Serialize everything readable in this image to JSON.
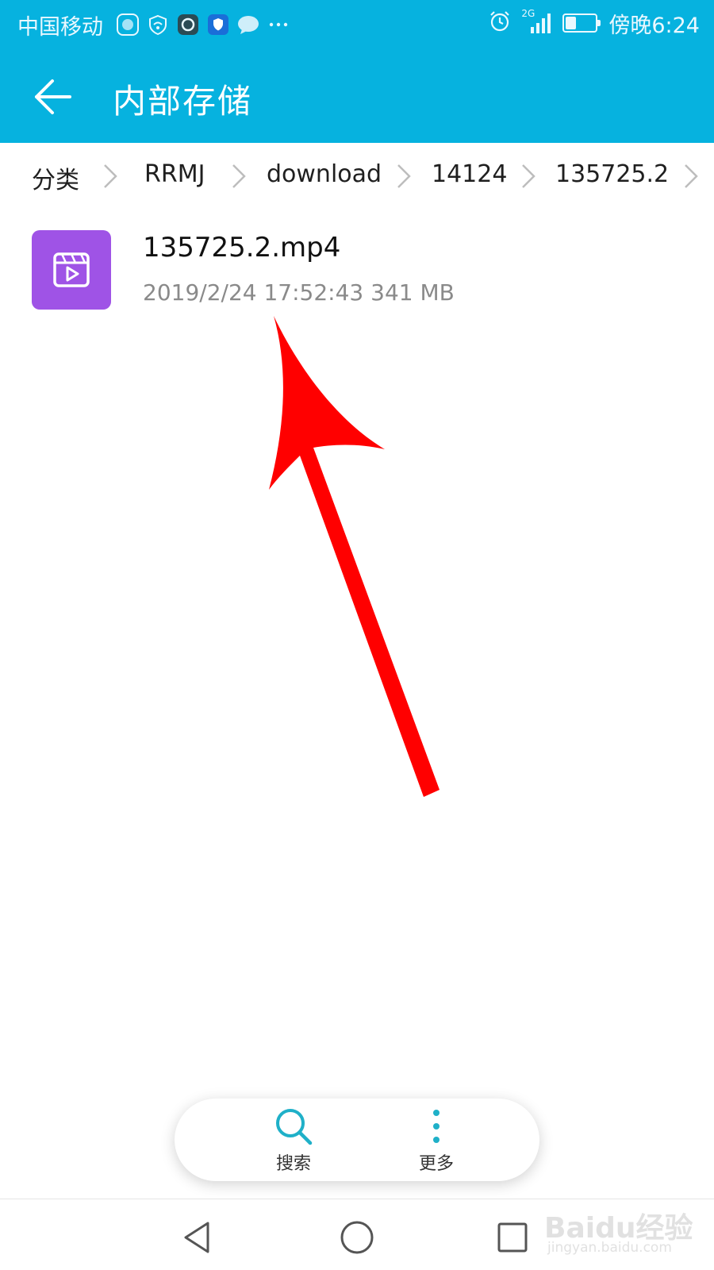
{
  "status_bar": {
    "carrier": "中国移动",
    "network_label": "2G",
    "time": "傍晚6:24",
    "battery_level": 0.35
  },
  "header": {
    "title": "内部存储"
  },
  "breadcrumb": {
    "items": [
      "分类",
      "RRMJ",
      "download",
      "14124",
      "135725.2"
    ]
  },
  "files": [
    {
      "name": "135725.2.mp4",
      "meta": "2019/2/24 17:52:43 341 MB"
    }
  ],
  "actions": {
    "search_label": "搜索",
    "more_label": "更多"
  },
  "watermark": {
    "brand": "Baidu经验",
    "url": "jingyan.baidu.com"
  },
  "colors": {
    "accent": "#06b2df",
    "video_thumb": "#9f53e6",
    "annotation_arrow": "#ff0000"
  }
}
